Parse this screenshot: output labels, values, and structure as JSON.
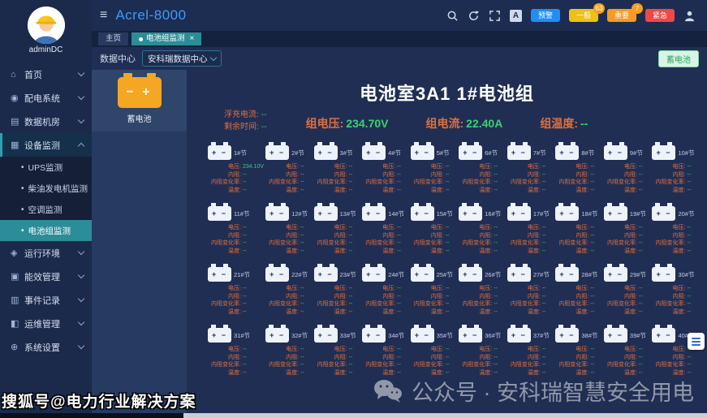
{
  "topbar": {
    "title": "Acrel-8000",
    "font_icon_label": "A",
    "alarms": [
      {
        "label": "预警",
        "count": "",
        "color": "#1f8ef5"
      },
      {
        "label": "一般",
        "count": "63",
        "color": "#edc213"
      },
      {
        "label": "重要",
        "count": "7",
        "color": "#f59a23"
      },
      {
        "label": "紧急",
        "count": "",
        "color": "#f04848"
      }
    ]
  },
  "tabs": {
    "home": "主页",
    "active": "电池组监测"
  },
  "toolbar": {
    "datacenter_label": "数据中心",
    "datacenter_value": "安科瑞数据中心",
    "battery_type_button": "蓄电池"
  },
  "sidebar": {
    "user": "adminDC",
    "menu": [
      {
        "key": "home",
        "icon": "home-icon",
        "label": "首页"
      },
      {
        "key": "distribution",
        "icon": "distribution-system-icon",
        "label": "配电系统"
      },
      {
        "key": "server-room",
        "icon": "server-room-icon",
        "label": "数据机房"
      },
      {
        "key": "device-monitor",
        "icon": "device-monitor-icon",
        "label": "设备监测",
        "expanded": true,
        "children": [
          "UPS监测",
          "柴油发电机监测",
          "空调监测",
          "电池组监测"
        ],
        "active_child": "电池组监测"
      },
      {
        "key": "environment",
        "icon": "environment-icon",
        "label": "运行环境"
      },
      {
        "key": "energy",
        "icon": "energy-icon",
        "label": "能效管理"
      },
      {
        "key": "events",
        "icon": "event-log-icon",
        "label": "事件记录"
      },
      {
        "key": "ops",
        "icon": "ops-icon",
        "label": "运维管理"
      },
      {
        "key": "settings",
        "icon": "settings-icon",
        "label": "系统设置"
      }
    ]
  },
  "device_panel": {
    "battery_label": "蓄电池"
  },
  "main": {
    "title": "电池室3A1  1#电池组",
    "float_stats": [
      {
        "label": "浮充电流:",
        "value": "--"
      },
      {
        "label": "剩余时间:",
        "value": "--"
      }
    ],
    "group_stats": [
      {
        "label": "组电压:",
        "value": "234.70V"
      },
      {
        "label": "组电流:",
        "value": "22.40A"
      },
      {
        "label": "组温度:",
        "value": "--"
      }
    ],
    "cell_field_labels": [
      "电压:",
      "内阻:",
      "内阻变化率:",
      "温度:"
    ],
    "cells": [
      {
        "name": "1#节",
        "values": [
          "234.10V",
          "--",
          "--",
          "--"
        ]
      },
      {
        "name": "2#节",
        "values": [
          "--",
          "--",
          "--",
          "--"
        ]
      },
      {
        "name": "3#节",
        "values": [
          "--",
          "--",
          "--",
          "--"
        ]
      },
      {
        "name": "4#节",
        "values": [
          "--",
          "--",
          "--",
          "--"
        ]
      },
      {
        "name": "5#节",
        "values": [
          "--",
          "--",
          "--",
          "--"
        ]
      },
      {
        "name": "6#节",
        "values": [
          "--",
          "--",
          "--",
          "--"
        ]
      },
      {
        "name": "7#节",
        "values": [
          "--",
          "--",
          "--",
          "--"
        ]
      },
      {
        "name": "8#节",
        "values": [
          "--",
          "--",
          "--",
          "--"
        ]
      },
      {
        "name": "9#节",
        "values": [
          "--",
          "--",
          "--",
          "--"
        ]
      },
      {
        "name": "10#节",
        "values": [
          "--",
          "--",
          "--",
          "--"
        ]
      },
      {
        "name": "11#节",
        "values": [
          "--",
          "--",
          "--",
          "--"
        ]
      },
      {
        "name": "12#节",
        "values": [
          "--",
          "--",
          "--",
          "--"
        ]
      },
      {
        "name": "13#节",
        "values": [
          "--",
          "--",
          "--",
          "--"
        ]
      },
      {
        "name": "14#节",
        "values": [
          "--",
          "--",
          "--",
          "--"
        ]
      },
      {
        "name": "15#节",
        "values": [
          "--",
          "--",
          "--",
          "--"
        ]
      },
      {
        "name": "16#节",
        "values": [
          "--",
          "--",
          "--",
          "--"
        ]
      },
      {
        "name": "17#节",
        "values": [
          "--",
          "--",
          "--",
          "--"
        ]
      },
      {
        "name": "18#节",
        "values": [
          "--",
          "--",
          "--",
          "--"
        ]
      },
      {
        "name": "19#节",
        "values": [
          "--",
          "--",
          "--",
          "--"
        ]
      },
      {
        "name": "20#节",
        "values": [
          "--",
          "--",
          "--",
          "--"
        ]
      },
      {
        "name": "21#节",
        "values": [
          "--",
          "--",
          "--",
          "--"
        ]
      },
      {
        "name": "22#节",
        "values": [
          "--",
          "--",
          "--",
          "--"
        ]
      },
      {
        "name": "23#节",
        "values": [
          "--",
          "--",
          "--",
          "--"
        ]
      },
      {
        "name": "24#节",
        "values": [
          "--",
          "--",
          "--",
          "--"
        ]
      },
      {
        "name": "25#节",
        "values": [
          "--",
          "--",
          "--",
          "--"
        ]
      },
      {
        "name": "26#节",
        "values": [
          "--",
          "--",
          "--",
          "--"
        ]
      },
      {
        "name": "27#节",
        "values": [
          "--",
          "--",
          "--",
          "--"
        ]
      },
      {
        "name": "28#节",
        "values": [
          "--",
          "--",
          "--",
          "--"
        ]
      },
      {
        "name": "29#节",
        "values": [
          "--",
          "--",
          "--",
          "--"
        ]
      },
      {
        "name": "30#节",
        "values": [
          "--",
          "--",
          "--",
          "--"
        ]
      },
      {
        "name": "31#节",
        "values": [
          "--",
          "--",
          "--",
          "--"
        ]
      },
      {
        "name": "32#节",
        "values": [
          "--",
          "--",
          "--",
          "--"
        ]
      },
      {
        "name": "33#节",
        "values": [
          "--",
          "--",
          "--",
          "--"
        ]
      },
      {
        "name": "34#节",
        "values": [
          "--",
          "--",
          "--",
          "--"
        ]
      },
      {
        "name": "35#节",
        "values": [
          "--",
          "--",
          "--",
          "--"
        ]
      },
      {
        "name": "36#节",
        "values": [
          "--",
          "--",
          "--",
          "--"
        ]
      },
      {
        "name": "37#节",
        "values": [
          "--",
          "--",
          "--",
          "--"
        ]
      },
      {
        "name": "38#节",
        "values": [
          "--",
          "--",
          "--",
          "--"
        ]
      },
      {
        "name": "39#节",
        "values": [
          "--",
          "--",
          "--",
          "--"
        ]
      },
      {
        "name": "40#节",
        "values": [
          "--",
          "--",
          "--",
          "--"
        ]
      }
    ]
  },
  "watermarks": {
    "sohu": "搜狐号@电力行业解决方案",
    "wechat": "公众号 · 安科瑞智慧安全用电"
  }
}
